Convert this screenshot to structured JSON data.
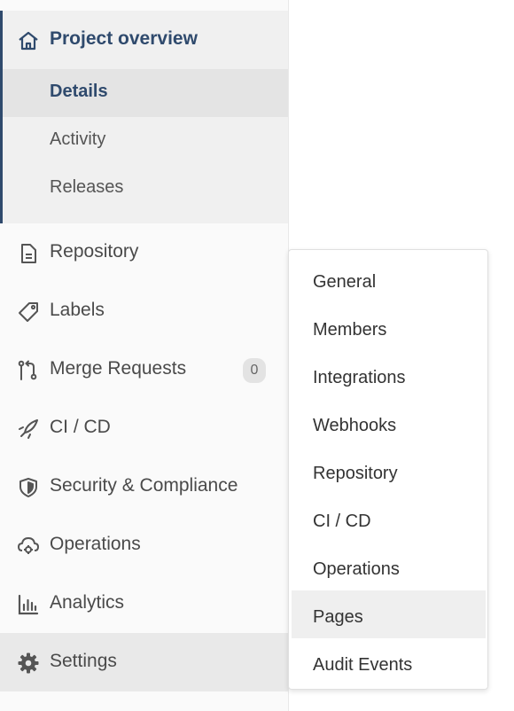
{
  "sidebar": {
    "project_overview": {
      "label": "Project overview",
      "icon": "home-icon",
      "items": [
        {
          "label": "Details",
          "active": true
        },
        {
          "label": "Activity"
        },
        {
          "label": "Releases"
        }
      ]
    },
    "items": [
      {
        "label": "Repository",
        "icon": "document-icon"
      },
      {
        "label": "Labels",
        "icon": "label-tag-icon"
      },
      {
        "label": "Merge Requests",
        "icon": "merge-request-icon",
        "badge": "0"
      },
      {
        "label": "CI / CD",
        "icon": "rocket-icon"
      },
      {
        "label": "Security & Compliance",
        "icon": "shield-icon"
      },
      {
        "label": "Operations",
        "icon": "cloud-gear-icon"
      },
      {
        "label": "Analytics",
        "icon": "bar-chart-icon"
      },
      {
        "label": "Settings",
        "icon": "gear-icon",
        "active": true
      }
    ]
  },
  "settings_flyout": {
    "items": [
      {
        "label": "General"
      },
      {
        "label": "Members"
      },
      {
        "label": "Integrations"
      },
      {
        "label": "Webhooks"
      },
      {
        "label": "Repository"
      },
      {
        "label": "CI / CD"
      },
      {
        "label": "Operations"
      },
      {
        "label": "Pages",
        "hovered": true
      },
      {
        "label": "Audit Events"
      }
    ]
  },
  "colors": {
    "accent": "#2f4a6d",
    "sidebar_bg": "#fafafa",
    "active_group_bg": "#f0f0f0",
    "active_item_bg": "#e4e4e4"
  }
}
